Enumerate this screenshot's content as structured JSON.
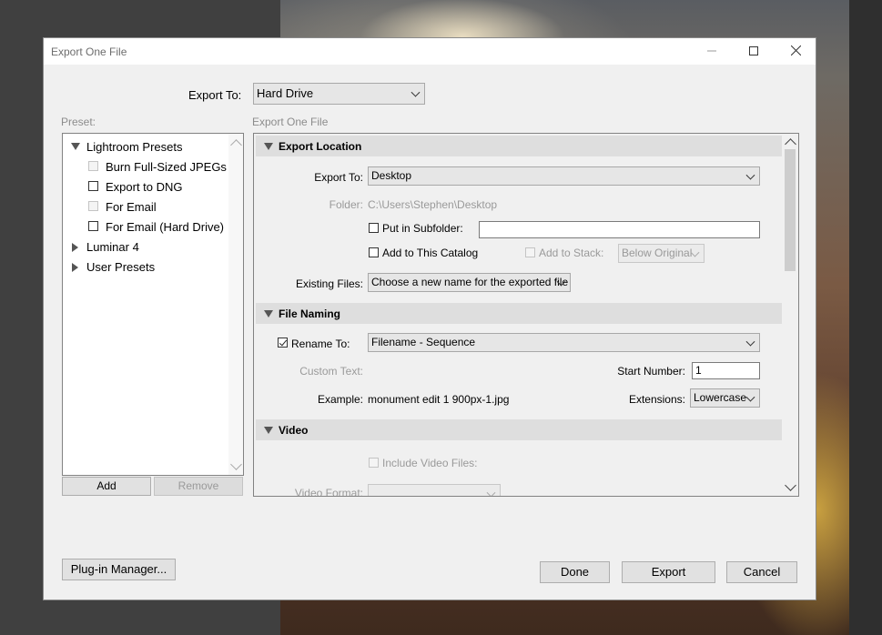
{
  "window": {
    "title": "Export One File",
    "minimize_icon": "minimize-icon",
    "maximize_icon": "maximize-icon",
    "close_icon": "close-icon"
  },
  "header": {
    "export_to_label": "Export To:",
    "export_to_value": "Hard Drive"
  },
  "preset": {
    "label": "Preset:",
    "groups": [
      {
        "name": "Lightroom Presets",
        "expanded": true
      },
      {
        "name": "Luminar 4",
        "expanded": false
      },
      {
        "name": "User Presets",
        "expanded": false
      }
    ],
    "items": [
      {
        "label": "Burn Full-Sized JPEGs",
        "enabled": false
      },
      {
        "label": "Export to DNG",
        "enabled": true
      },
      {
        "label": "For Email",
        "enabled": false
      },
      {
        "label": "For Email (Hard Drive)",
        "enabled": true
      }
    ],
    "add_label": "Add",
    "remove_label": "Remove"
  },
  "settings": {
    "caption": "Export One File",
    "export_location": {
      "title": "Export Location",
      "export_to_label": "Export To:",
      "export_to_value": "Desktop",
      "folder_label": "Folder:",
      "folder_value": "C:\\Users\\Stephen\\Desktop",
      "subfolder_label": "Put in Subfolder:",
      "subfolder_value": "",
      "catalog_label": "Add to This Catalog",
      "stack_label": "Add to Stack:",
      "stack_value": "Below Original",
      "existing_label": "Existing Files:",
      "existing_value": "Choose a new name for the exported file"
    },
    "file_naming": {
      "title": "File Naming",
      "rename_label": "Rename To:",
      "rename_checked": true,
      "rename_value": "Filename - Sequence",
      "custom_text_label": "Custom Text:",
      "start_number_label": "Start Number:",
      "start_number_value": "1",
      "example_label": "Example:",
      "example_value": "monument edit 1 900px-1.jpg",
      "extensions_label": "Extensions:",
      "extensions_value": "Lowercase"
    },
    "video": {
      "title": "Video",
      "include_label": "Include Video Files:",
      "format_label": "Video Format:"
    }
  },
  "footer": {
    "plugin_manager_label": "Plug-in Manager...",
    "done_label": "Done",
    "export_label": "Export",
    "cancel_label": "Cancel"
  }
}
